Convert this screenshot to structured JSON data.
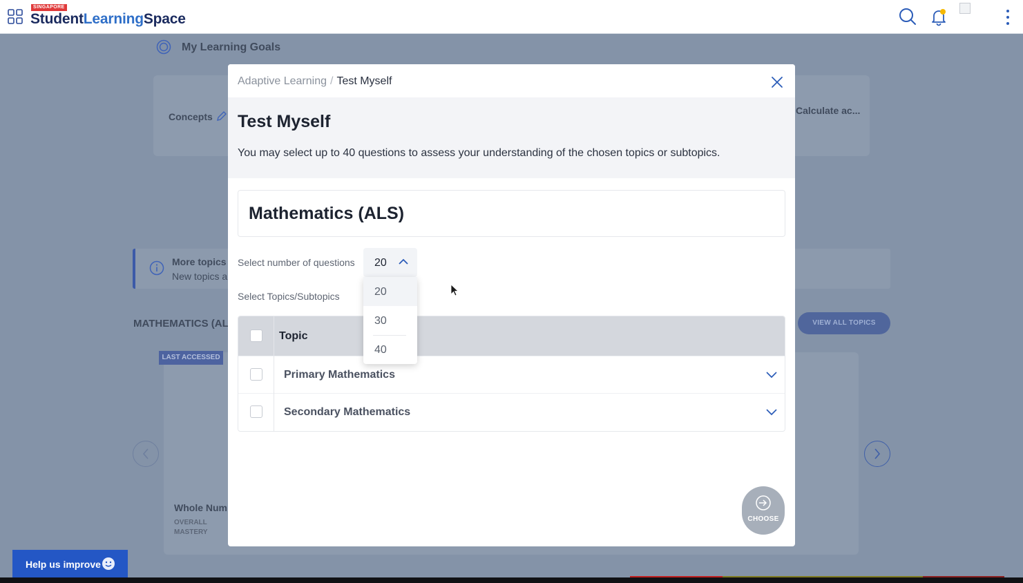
{
  "header": {
    "brand_tag": "SINGAPORE",
    "brand_part1": "Student",
    "brand_part2": "Learning",
    "brand_part3": "Space"
  },
  "background": {
    "goals_title": "My Learning Goals",
    "concepts_label": "Concepts",
    "calculate_label": "Calculate ac...",
    "info_title": "More topics",
    "info_text": "New topics a",
    "section_title": "MATHEMATICS (AL",
    "view_all_label": "VIEW ALL TOPICS",
    "last_accessed_label": "LAST ACCESSED",
    "card_title": "Whole Num",
    "card_sub1": "OVERALL",
    "card_sub2": "MASTERY"
  },
  "help": {
    "label": "Help us improve"
  },
  "modal": {
    "breadcrumb": [
      "Adaptive Learning",
      "Test Myself"
    ],
    "breadcrumb_sep": "/",
    "title": "Test Myself",
    "description": "You may select up to 40 questions to assess your understanding of the chosen topics or subtopics.",
    "subject": "Mathematics (ALS)",
    "num_questions_label": "Select number of questions",
    "num_questions_value": "20",
    "num_questions_options": [
      "20",
      "30",
      "40"
    ],
    "topics_label": "Select Topics/Subtopics",
    "table": {
      "header": "Topic",
      "rows": [
        "Primary Mathematics",
        "Secondary Mathematics"
      ]
    },
    "choose_label": "CHOOSE"
  },
  "colors": {
    "brand_dark": "#1a2a5e",
    "brand_blue": "#2f6fc8",
    "overlay": "#8493a8",
    "help_button": "#2457c5",
    "bell_dot": "#f5b800"
  }
}
